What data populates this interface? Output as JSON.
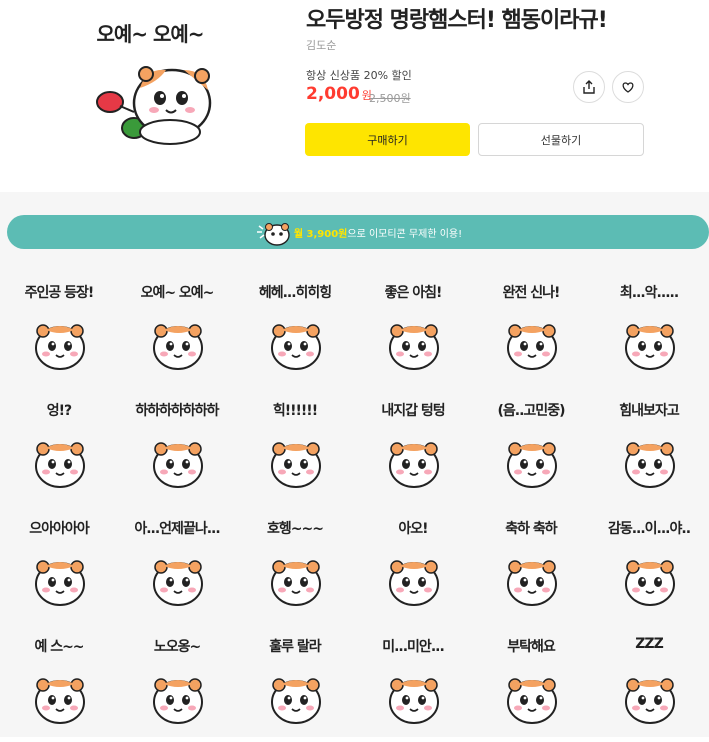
{
  "product": {
    "thumbnail_caption": "오예~ 오예~",
    "title": "오두방정 명랑햄스터! 햄동이라규!",
    "author": "김도순",
    "promo": "항상 신상품 20% 할인",
    "price": "2,000",
    "price_unit": "원",
    "original_price": "2,500원",
    "share_icon": "share-icon",
    "like_icon": "heart-icon",
    "buy_label": "구매하기",
    "gift_label": "선물하기"
  },
  "banner": {
    "highlight": "월 3,900원",
    "rest": "으로 이모티콘 무제한 이용!"
  },
  "stickers": [
    {
      "text": "주인공 등장!"
    },
    {
      "text": "오예~ 오예~"
    },
    {
      "text": "헤헤...히히힝"
    },
    {
      "text": "좋은 아침!"
    },
    {
      "text": "완전 신나!"
    },
    {
      "text": "최...악....."
    },
    {
      "text": "엉!?"
    },
    {
      "text": "하하하하하하하"
    },
    {
      "text": "힉!!!!!!"
    },
    {
      "text": "내지갑 텅텅"
    },
    {
      "text": "(음..고민중)"
    },
    {
      "text": "힘내보자고"
    },
    {
      "text": "으아아아아"
    },
    {
      "text": "아...언제끝나..."
    },
    {
      "text": "호헹~~~"
    },
    {
      "text": "아오!"
    },
    {
      "text": "축하 축하"
    },
    {
      "text": "감동...이...야.."
    },
    {
      "text": "예 스~~"
    },
    {
      "text": "노오옹~"
    },
    {
      "text": "훌루 랄라"
    },
    {
      "text": "미...미안..."
    },
    {
      "text": "부탁해요"
    },
    {
      "text": "ZZZ"
    }
  ],
  "colors": {
    "accent_yellow": "#fee500",
    "price_red": "#ff3b30",
    "banner_teal": "#5cbcb4",
    "hamster_orange": "#f4a261"
  }
}
